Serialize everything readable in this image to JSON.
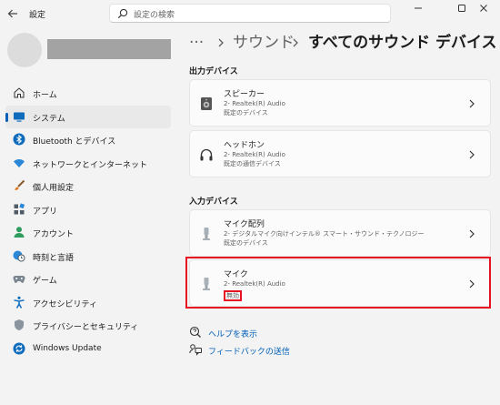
{
  "titlebar": {
    "app_title": "設定",
    "search_placeholder": "設定の検索"
  },
  "sidebar": {
    "items": [
      {
        "label": "ホーム",
        "icon": "home-icon"
      },
      {
        "label": "システム",
        "icon": "system-icon",
        "active": true
      },
      {
        "label": "Bluetooth とデバイス",
        "icon": "bluetooth-icon"
      },
      {
        "label": "ネットワークとインターネット",
        "icon": "network-icon"
      },
      {
        "label": "個人用設定",
        "icon": "brush-icon"
      },
      {
        "label": "アプリ",
        "icon": "apps-icon"
      },
      {
        "label": "アカウント",
        "icon": "account-icon"
      },
      {
        "label": "時刻と言語",
        "icon": "clock-globe-icon"
      },
      {
        "label": "ゲーム",
        "icon": "gamepad-icon"
      },
      {
        "label": "アクセシビリティ",
        "icon": "accessibility-icon"
      },
      {
        "label": "プライバシーとセキュリティ",
        "icon": "shield-icon"
      },
      {
        "label": "Windows Update",
        "icon": "update-icon"
      }
    ]
  },
  "breadcrumb": {
    "more": "···",
    "parent": "サウンド",
    "current": "すべてのサウンド デバイス"
  },
  "output": {
    "section_title": "出力デバイス",
    "devices": [
      {
        "name": "スピーカー",
        "line1": "2- Realtek(R) Audio",
        "line2": "既定のデバイス",
        "icon": "speaker-icon"
      },
      {
        "name": "ヘッドホン",
        "line1": "2- Realtek(R) Audio",
        "line2": "既定の通信デバイス",
        "icon": "headphones-icon"
      }
    ]
  },
  "input": {
    "section_title": "入力デバイス",
    "devices": [
      {
        "name": "マイク配列",
        "line1": "2- デジタルマイク向けインテル® スマート・サウンド・テクノロジー",
        "line2": "既定のデバイス",
        "icon": "microphone-icon"
      },
      {
        "name": "マイク",
        "line1": "2- Realtek(R) Audio",
        "line2": "無効",
        "icon": "microphone-icon"
      }
    ]
  },
  "help": {
    "show_help": "ヘルプを表示",
    "send_feedback": "フィードバックの送信"
  },
  "colors": {
    "accent": "#005fb8",
    "highlight": "#e81123"
  }
}
